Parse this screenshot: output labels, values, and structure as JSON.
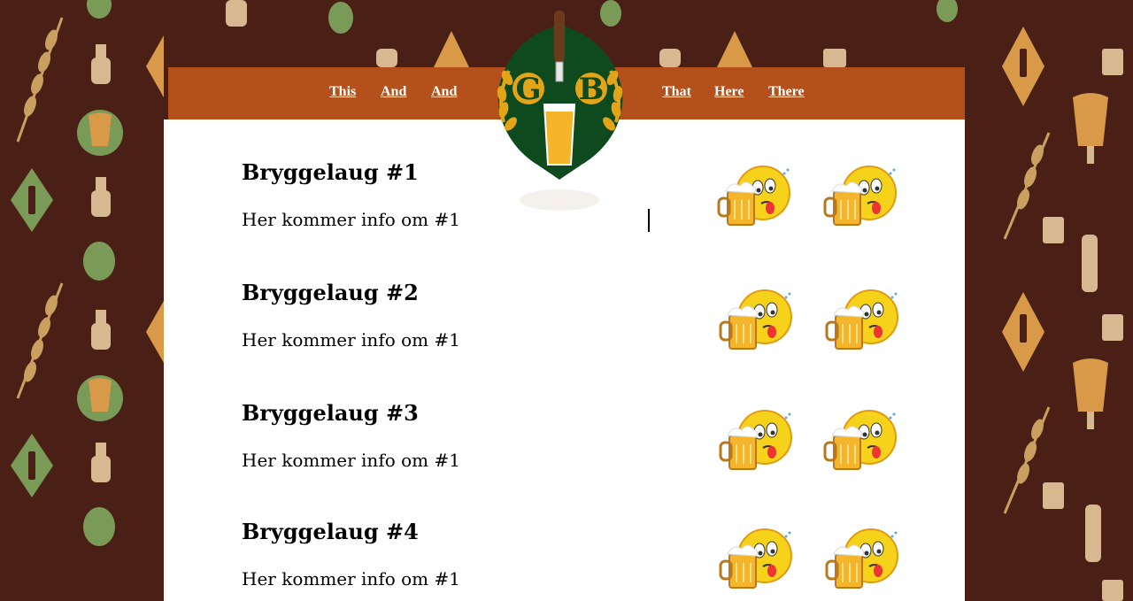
{
  "nav": {
    "left": [
      "This",
      "And",
      "And"
    ],
    "right": [
      "That",
      "Here",
      "There"
    ]
  },
  "logo": {
    "letters": [
      "G",
      "B"
    ]
  },
  "entries": [
    {
      "title": "Bryggelaug #1",
      "text": "Her kommer info om #1"
    },
    {
      "title": "Bryggelaug #2",
      "text": "Her kommer info om #1"
    },
    {
      "title": "Bryggelaug #3",
      "text": "Her kommer info om #1"
    },
    {
      "title": "Bryggelaug #4",
      "text": "Her kommer info om #1"
    }
  ],
  "colors": {
    "background": "#4a2016",
    "navbar": "#b3501b",
    "content": "#ffffff",
    "logo_green": "#0f4a1e",
    "logo_gold": "#e3a418"
  },
  "icons": [
    "beer-emoji-icon",
    "hop-icon",
    "wheat-icon",
    "bottle-icon",
    "growler-icon",
    "beer-glass-icon",
    "mug-icon"
  ]
}
